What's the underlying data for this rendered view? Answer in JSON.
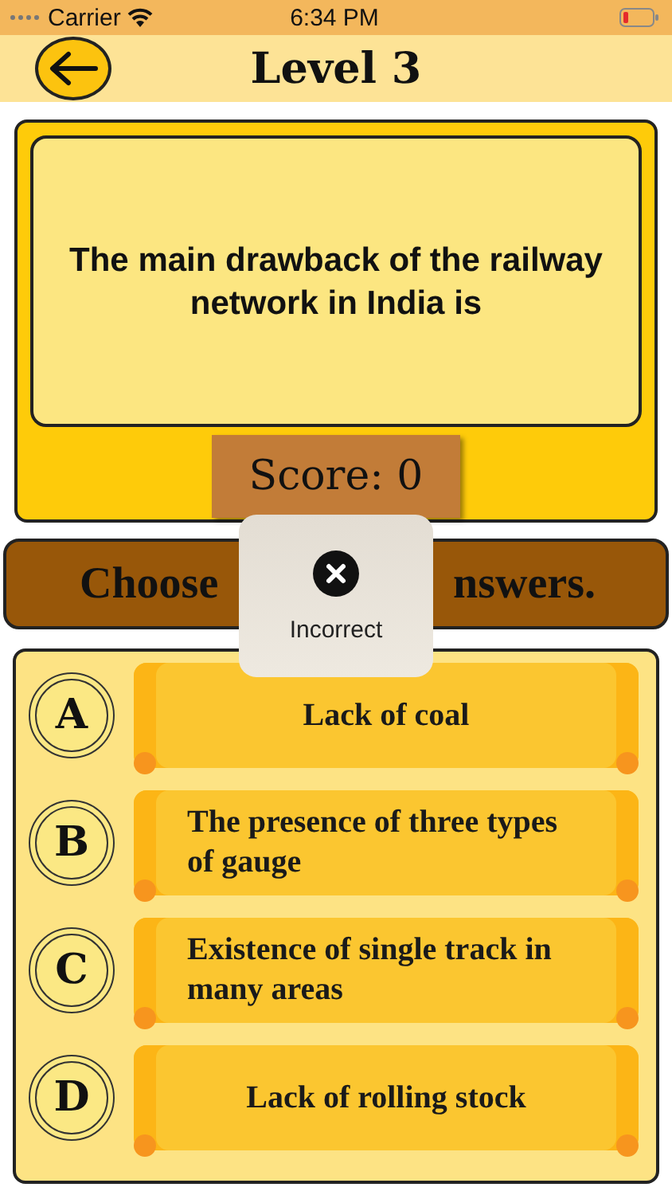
{
  "status_bar": {
    "carrier": "Carrier",
    "time": "6:34 PM"
  },
  "header": {
    "title": "Level 3"
  },
  "question": {
    "text": "The main drawback of the railway network in India is",
    "score": "Score: 0"
  },
  "banner": {
    "visible_left": "Choose",
    "visible_right": "nswers."
  },
  "toast": {
    "message": "Incorrect"
  },
  "answers": [
    {
      "letter": "A",
      "text": "Lack of coal"
    },
    {
      "letter": "B",
      "text": "The presence of three types of gauge"
    },
    {
      "letter": "C",
      "text": "Existence of single track in many areas"
    },
    {
      "letter": "D",
      "text": "Lack of rolling stock"
    }
  ]
}
